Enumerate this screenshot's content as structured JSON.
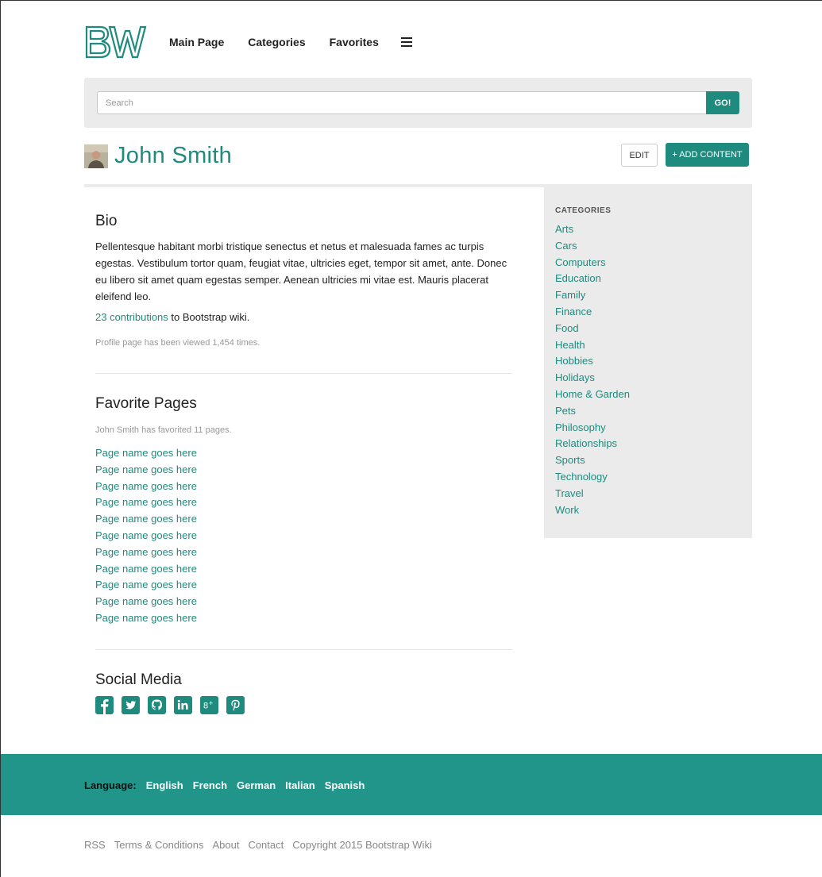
{
  "header": {
    "logo_text": "BW",
    "nav": [
      "Main Page",
      "Categories",
      "Favorites"
    ],
    "menu_icon": "hamburger-icon"
  },
  "search": {
    "placeholder": "Search",
    "button_label": "GO!"
  },
  "profile": {
    "name": "John Smith",
    "edit_label": "EDIT",
    "add_content_label": "+ ADD CONTENT"
  },
  "bio": {
    "heading": "Bio",
    "text": "Pellentesque habitant morbi tristique senectus et netus et malesuada fames ac turpis egestas. Vestibulum tortor quam, feugiat vitae, ultricies eget, tempor sit amet, ante. Donec eu libero sit amet quam egestas semper. Aenean ultricies mi vitae est. Mauris placerat eleifend leo.",
    "contributions_link": "23 contributions",
    "contributions_suffix": " to Bootstrap wiki.",
    "views": "Profile page has been viewed 1,454 times."
  },
  "favorites": {
    "heading": "Favorite Pages",
    "count_text": "John Smith has favorited 11 pages.",
    "pages": [
      "Page name goes here",
      "Page name goes here",
      "Page name goes here",
      "Page name goes here",
      "Page name goes here",
      "Page name goes here",
      "Page name goes here",
      "Page name goes here",
      "Page name goes here",
      "Page name goes here",
      "Page name goes here"
    ]
  },
  "social": {
    "heading": "Social Media",
    "icons": [
      "facebook-icon",
      "twitter-icon",
      "github-icon",
      "linkedin-icon",
      "google-plus-icon",
      "pinterest-icon"
    ]
  },
  "sidebar": {
    "heading": "CATEGORIES",
    "categories": [
      "Arts",
      "Cars",
      "Computers",
      "Education",
      "Family",
      "Finance",
      "Food",
      "Health",
      "Hobbies",
      "Holidays",
      "Home & Garden",
      "Pets",
      "Philosophy",
      "Relationships",
      "Sports",
      "Technology",
      "Travel",
      "Work"
    ]
  },
  "footer": {
    "language_label": "Language:",
    "languages": [
      "English",
      "French",
      "German",
      "Italian",
      "Spanish"
    ],
    "links": [
      "RSS",
      "Terms & Conditions",
      "About",
      "Contact"
    ],
    "copyright": "Copyright 2015 Bootstrap Wiki"
  },
  "colors": {
    "accent": "#1f8a7e",
    "footer_band": "#21958a",
    "panel": "#ebebeb"
  }
}
